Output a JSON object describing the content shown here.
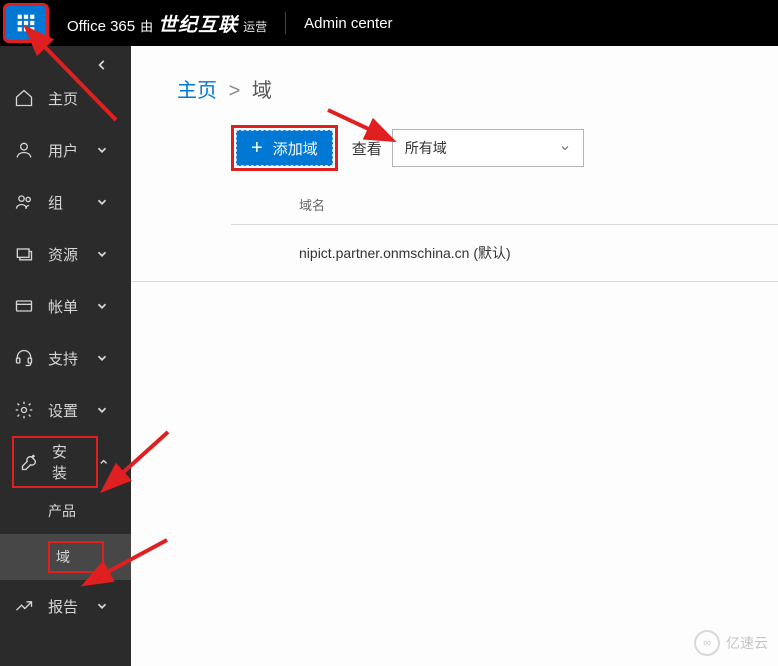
{
  "topbar": {
    "office": "Office 365",
    "by": "由",
    "cn_brand": "世纪互联",
    "operated": "运营",
    "admin_center": "Admin center"
  },
  "sidebar": {
    "items": [
      {
        "label": "主页"
      },
      {
        "label": "用户"
      },
      {
        "label": "组"
      },
      {
        "label": "资源"
      },
      {
        "label": "帐单"
      },
      {
        "label": "支持"
      },
      {
        "label": "设置"
      },
      {
        "label": "安装"
      },
      {
        "label": "报告"
      }
    ],
    "install_children": [
      {
        "label": "产品"
      },
      {
        "label": "域"
      }
    ]
  },
  "breadcrumb": {
    "home": "主页",
    "current": "域",
    "sep": ">"
  },
  "toolbar": {
    "add_domain": "添加域",
    "view_label": "查看",
    "view_value": "所有域"
  },
  "table": {
    "col_domain": "域名",
    "rows": [
      {
        "domain": "nipict.partner.onmschina.cn (默认)"
      }
    ]
  },
  "watermark": "亿速云"
}
